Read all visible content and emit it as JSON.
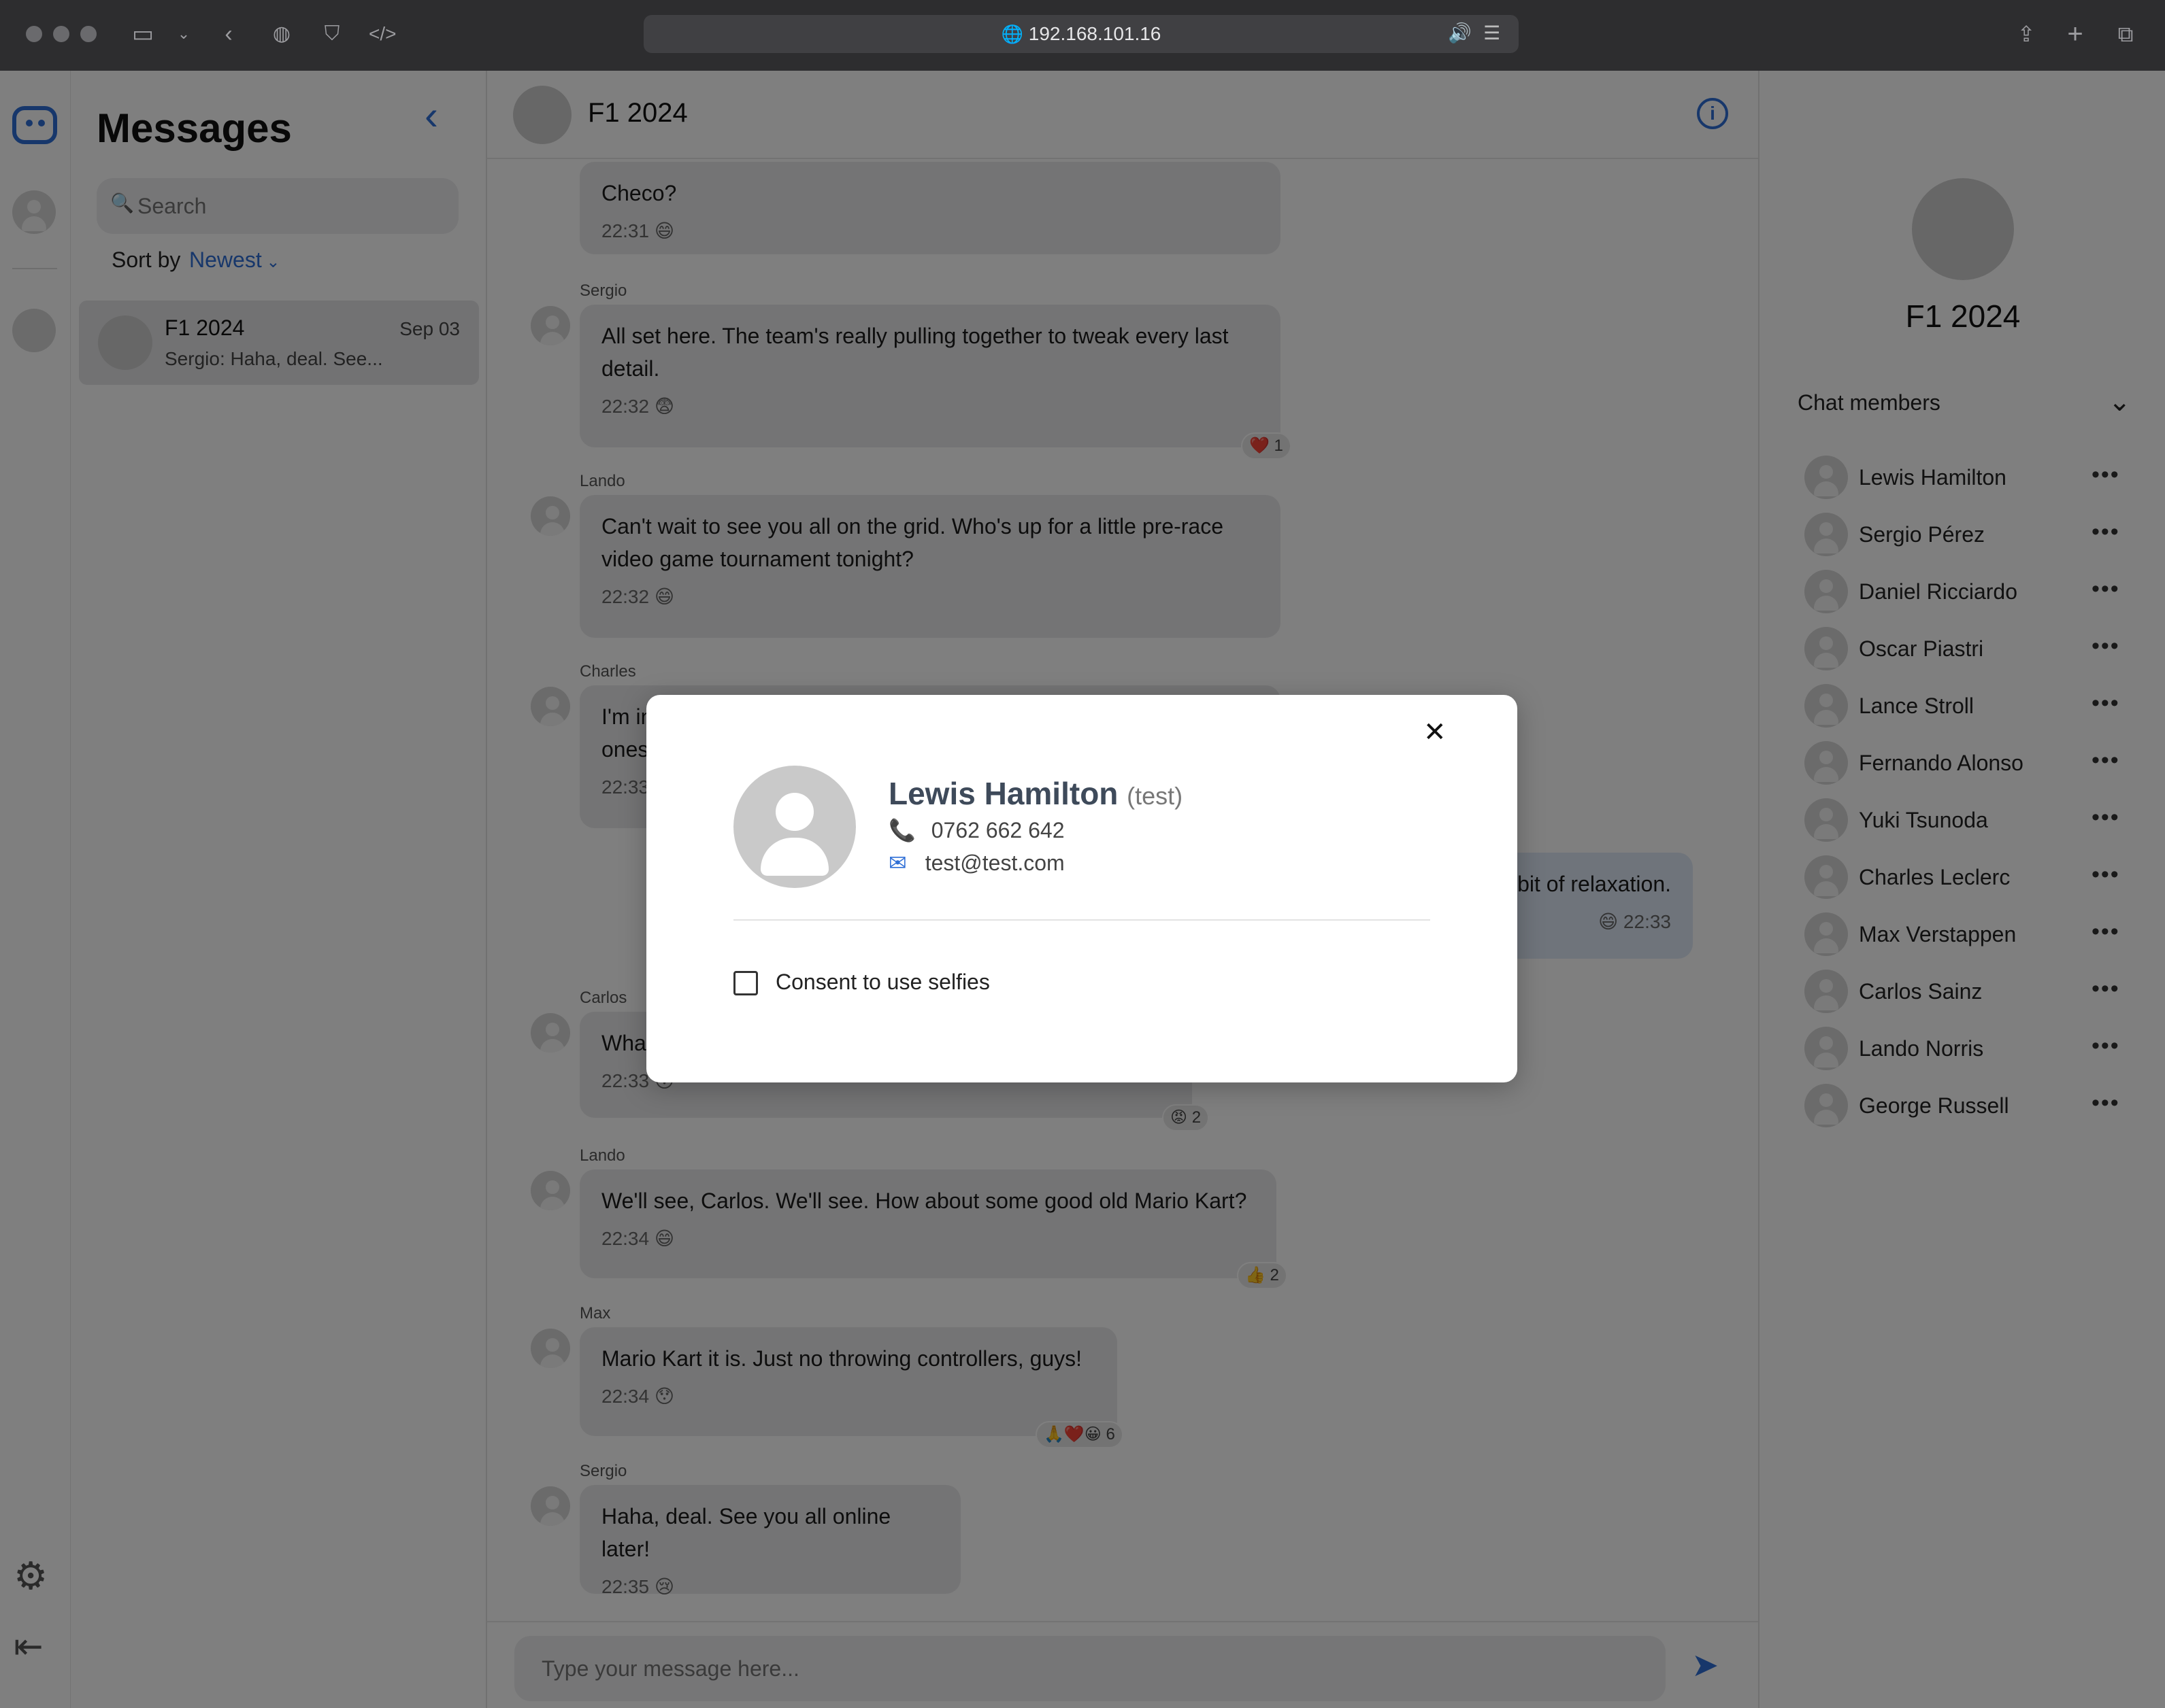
{
  "browser": {
    "url": "192.168.101.16"
  },
  "sidebar": {
    "title": "Messages",
    "search_placeholder": "Search",
    "sort_label": "Sort by",
    "sort_value": "Newest",
    "conversations": [
      {
        "name": "F1 2024",
        "date": "Sep 03",
        "preview": "Sergio: Haha, deal. See..."
      }
    ]
  },
  "chat": {
    "title": "F1 2024",
    "composer_placeholder": "Type your message here...",
    "messages": [
      {
        "sender": "",
        "text": "Checo?",
        "time": "22:31",
        "emoji": "😄"
      },
      {
        "sender": "Sergio",
        "text": "All set here. The team's really pulling together to tweak every last detail.",
        "time": "22:32",
        "emoji": "😨",
        "reaction": "❤️ 1"
      },
      {
        "sender": "Lando",
        "text": "Can't wait to see you all on the grid. Who's up for a little pre-race video game tournament tonight?",
        "time": "22:32",
        "emoji": "😄"
      },
      {
        "sender": "Charles",
        "text": "I'm in",
        "line2": "ones",
        "time": "22:33"
      },
      {
        "sender": "",
        "text": "a bit of relaxation.",
        "time": "22:33",
        "emoji": "😄",
        "own": true
      },
      {
        "sender": "Carlos",
        "text": "Wha",
        "time": "22:33",
        "emoji": "😯",
        "reaction": "😡 2"
      },
      {
        "sender": "Lando",
        "text": "We'll see, Carlos. We'll see. How about some good old Mario Kart?",
        "time": "22:34",
        "emoji": "😄",
        "reaction": "👍 2"
      },
      {
        "sender": "Max",
        "text": "Mario Kart it is. Just no throwing controllers, guys!",
        "time": "22:34",
        "emoji": "😯",
        "reaction": "🙏❤️😀 6"
      },
      {
        "sender": "Sergio",
        "text": "Haha, deal. See you all online later!",
        "time": "22:35",
        "emoji": "😢"
      }
    ]
  },
  "info": {
    "title": "F1 2024",
    "members_label": "Chat members",
    "members": [
      "Lewis Hamilton",
      "Sergio Pérez",
      "Daniel Ricciardo",
      "Oscar Piastri",
      "Lance Stroll",
      "Fernando Alonso",
      "Yuki Tsunoda",
      "Charles Leclerc",
      "Max Verstappen",
      "Carlos Sainz",
      "Lando Norris",
      "George Russell"
    ],
    "more_label": "•••"
  },
  "modal": {
    "name": "Lewis Hamilton",
    "tag": "(test)",
    "phone": "0762 662 642",
    "email": "test@test.com",
    "consent_label": "Consent to use selfies",
    "close_label": "✕"
  },
  "colors": {
    "accent": "#2f6fd6",
    "bubble": "#e9e9ea",
    "own_bubble": "#dfe9f7"
  }
}
